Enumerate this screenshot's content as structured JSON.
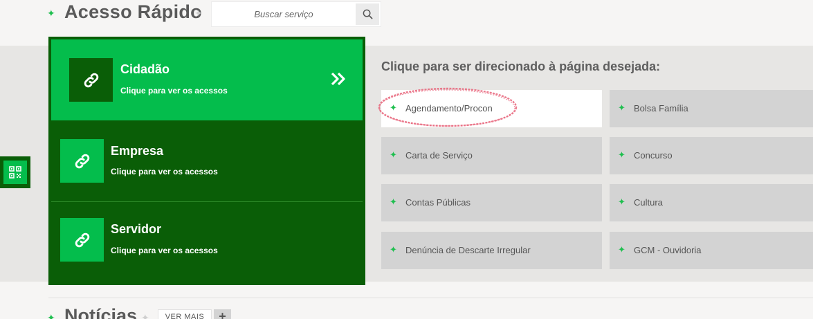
{
  "header": {
    "title": "Acesso Rápido",
    "search": {
      "placeholder": "Buscar serviço",
      "value": ""
    }
  },
  "categories": [
    {
      "title": "Cidadão",
      "subtitle": "Clique para ver os acessos",
      "active": true,
      "icon": "link-icon"
    },
    {
      "title": "Empresa",
      "subtitle": "Clique para ver os acessos",
      "active": false,
      "icon": "link-icon"
    },
    {
      "title": "Servidor",
      "subtitle": "Clique para ver os acessos",
      "active": false,
      "icon": "link-icon"
    }
  ],
  "instruction": "Clique para ser direcionado à página desejada:",
  "services": [
    "Agendamento/Procon",
    "Bolsa Família",
    "Carta de Serviço",
    "Concurso",
    "Contas Públicas",
    "Cultura",
    "Denúncia de Descarte Irregular",
    "GCM - Ouvidoria"
  ],
  "news": {
    "title": "Notícias",
    "more_label": "VER MAIS",
    "plus_label": "+"
  },
  "colors": {
    "dark_green": "#0a5e07",
    "bright_green": "#04bd4c",
    "accent_star": "#1fbf4f",
    "highlight_ring": "#e8647a"
  }
}
